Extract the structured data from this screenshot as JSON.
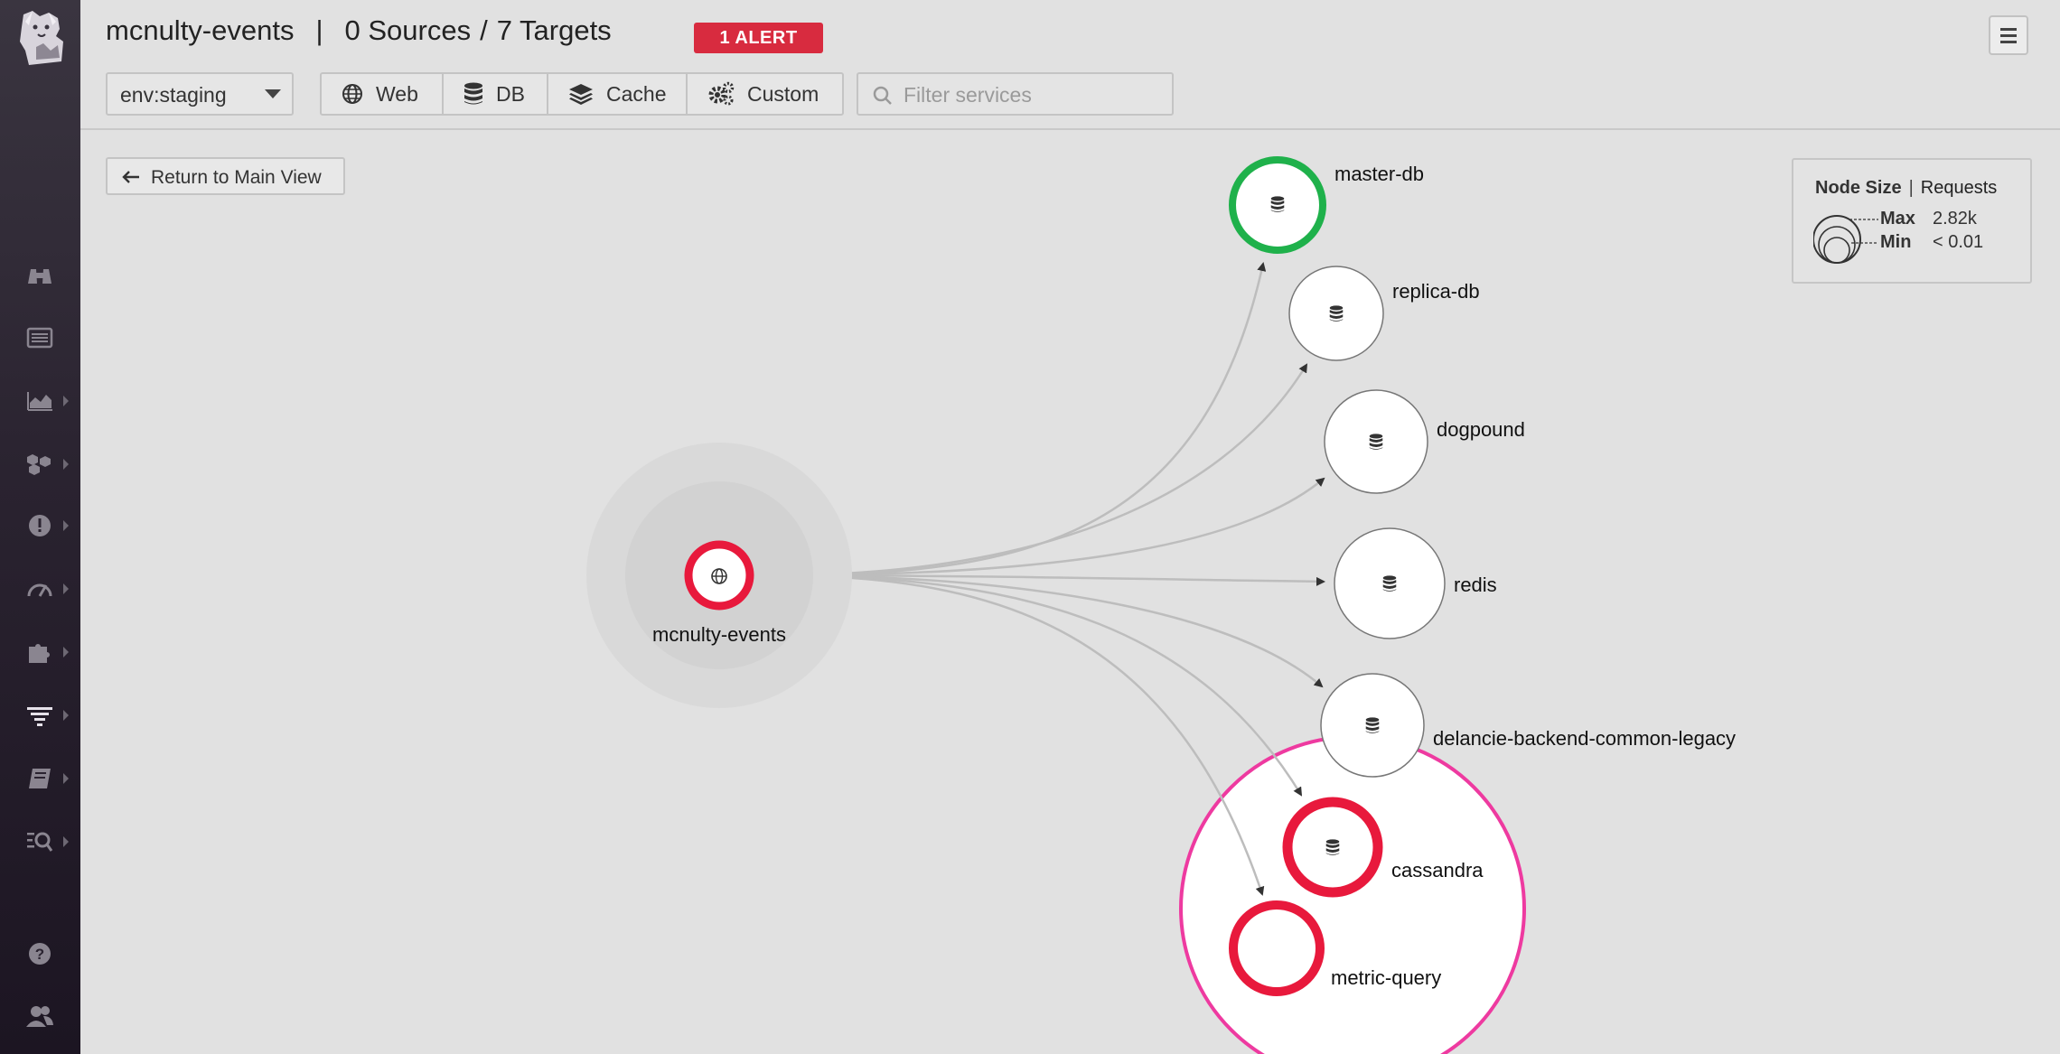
{
  "header": {
    "service_name": "mcnulty-events",
    "sources": "0 Sources",
    "targets": "7 Targets",
    "alert_badge": "1 ALERT"
  },
  "controls": {
    "env_value": "env:staging",
    "filters": [
      {
        "label": "Web",
        "icon": "globe-icon"
      },
      {
        "label": "DB",
        "icon": "database-icon"
      },
      {
        "label": "Cache",
        "icon": "layers-icon"
      },
      {
        "label": "Custom",
        "icon": "gears-icon"
      }
    ],
    "search_placeholder": "Filter services"
  },
  "return_label": "Return to Main View",
  "legend": {
    "title": "Node Size",
    "metric": "Requests",
    "max_label": "Max",
    "max_value": "2.82k",
    "min_label": "Min",
    "min_value": "< 0.01"
  },
  "colors": {
    "alert": "#e8193c",
    "ok": "#1fb14b",
    "focus": "#ee3aa0",
    "neutral": "#777777"
  },
  "graph": {
    "source": {
      "name": "mcnulty-events",
      "status": "alert",
      "icon": "globe-icon"
    },
    "targets": [
      {
        "name": "master-db",
        "status": "ok",
        "icon": "database-icon"
      },
      {
        "name": "replica-db",
        "status": "neutral",
        "icon": "database-icon"
      },
      {
        "name": "dogpound",
        "status": "neutral",
        "icon": "database-icon"
      },
      {
        "name": "redis",
        "status": "neutral",
        "icon": "database-icon"
      },
      {
        "name": "delancie-backend-common-legacy",
        "status": "neutral",
        "icon": "database-icon"
      },
      {
        "name": "cassandra",
        "status": "alert",
        "icon": "database-icon"
      },
      {
        "name": "metric-query",
        "status": "alert",
        "icon": ""
      }
    ]
  },
  "sidebar": {
    "items": [
      {
        "icon": "binoculars-icon"
      },
      {
        "icon": "list-icon"
      },
      {
        "icon": "area-chart-icon"
      },
      {
        "icon": "hexagons-icon"
      },
      {
        "icon": "alert-icon"
      },
      {
        "icon": "speedometer-icon"
      },
      {
        "icon": "puzzle-icon"
      },
      {
        "icon": "apm-icon"
      },
      {
        "icon": "notebook-icon"
      },
      {
        "icon": "log-search-icon"
      },
      {
        "icon": "help-icon"
      },
      {
        "icon": "team-icon"
      }
    ]
  }
}
